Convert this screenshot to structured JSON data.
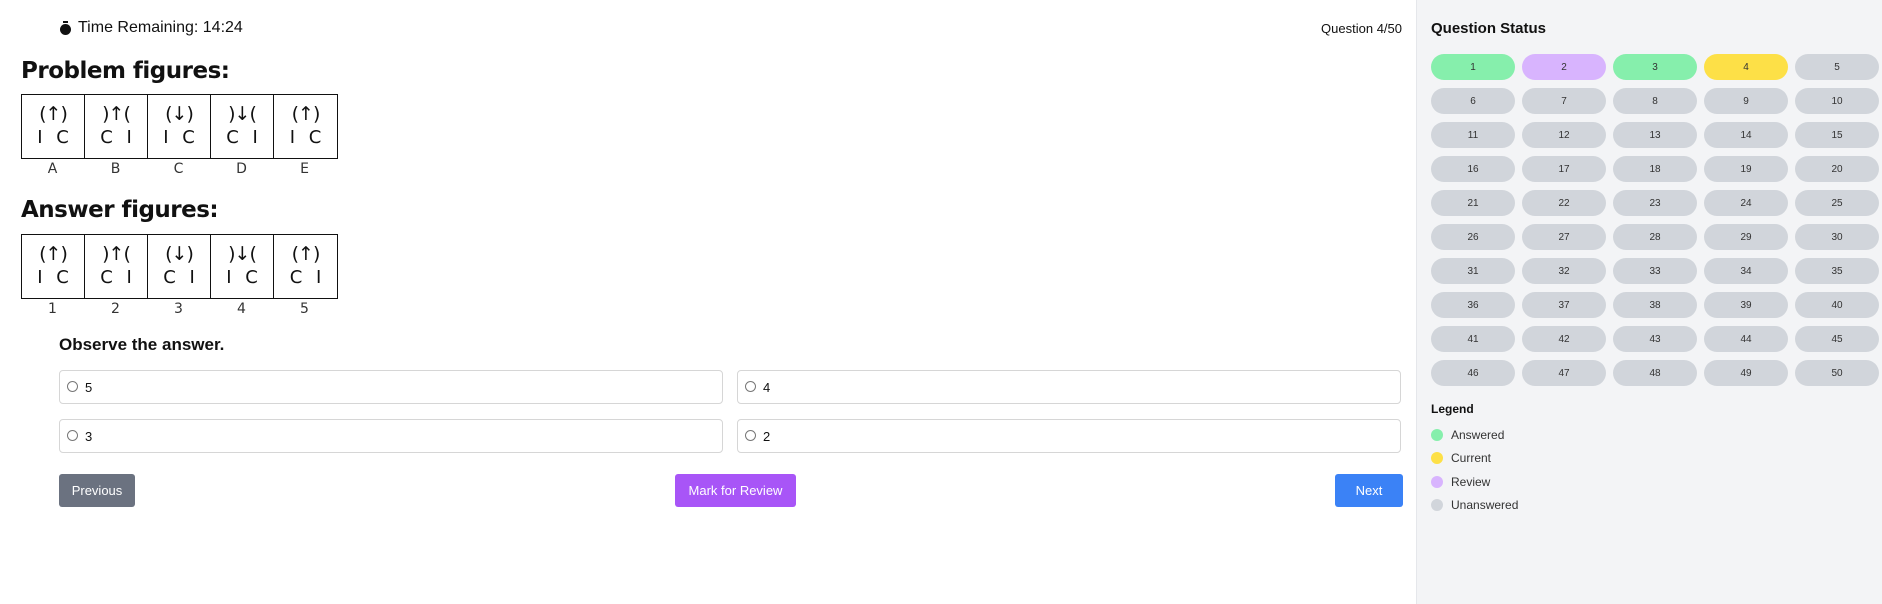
{
  "header": {
    "timer_text": "Time Remaining: 14:24",
    "question_counter": "Question 4/50"
  },
  "problem": {
    "heading": "Problem figures:",
    "figures": [
      {
        "top": "(↑)",
        "bottom": "I C",
        "label": "A"
      },
      {
        "top": ")↑(",
        "bottom": "C I",
        "label": "B"
      },
      {
        "top": "(↓)",
        "bottom": "I C",
        "label": "C"
      },
      {
        "top": ")↓(",
        "bottom": "C I",
        "label": "D"
      },
      {
        "top": "(↑)",
        "bottom": "I C",
        "label": "E"
      }
    ]
  },
  "answer": {
    "heading": "Answer figures:",
    "figures": [
      {
        "top": "(↑)",
        "bottom": "I C",
        "label": "1"
      },
      {
        "top": ")↑(",
        "bottom": "C I",
        "label": "2"
      },
      {
        "top": "(↓)",
        "bottom": "C I",
        "label": "3"
      },
      {
        "top": ")↓(",
        "bottom": "I C",
        "label": "4"
      },
      {
        "top": "(↑)",
        "bottom": "C I",
        "label": "5"
      }
    ]
  },
  "question": {
    "prompt": "Observe the answer.",
    "options": [
      "5",
      "4",
      "3",
      "2"
    ]
  },
  "buttons": {
    "previous": "Previous",
    "mark_review": "Mark for Review",
    "next": "Next"
  },
  "status_panel": {
    "title": "Question Status",
    "numbers": [
      "1",
      "2",
      "3",
      "4",
      "5",
      "6",
      "7",
      "8",
      "9",
      "10",
      "11",
      "12",
      "13",
      "14",
      "15",
      "16",
      "17",
      "18",
      "19",
      "20",
      "21",
      "22",
      "23",
      "24",
      "25",
      "26",
      "27",
      "28",
      "29",
      "30",
      "31",
      "32",
      "33",
      "34",
      "35",
      "36",
      "37",
      "38",
      "39",
      "40",
      "41",
      "42",
      "43",
      "44",
      "45",
      "46",
      "47",
      "48",
      "49",
      "50"
    ],
    "statuses": {
      "1": "answered",
      "2": "review",
      "3": "answered",
      "4": "current"
    },
    "legend_title": "Legend",
    "legend": [
      {
        "label": "Answered",
        "color": "#86efac"
      },
      {
        "label": "Current",
        "color": "#fde047"
      },
      {
        "label": "Review",
        "color": "#d8b4fe"
      },
      {
        "label": "Unanswered",
        "color": "#d1d5db"
      }
    ]
  },
  "colors": {
    "answered": "#86efac",
    "current": "#fde047",
    "review": "#d8b4fe",
    "unanswered": "#d1d5db",
    "previous_button": "#6b7280",
    "review_button": "#a855f7",
    "next_button": "#3b82f6"
  }
}
